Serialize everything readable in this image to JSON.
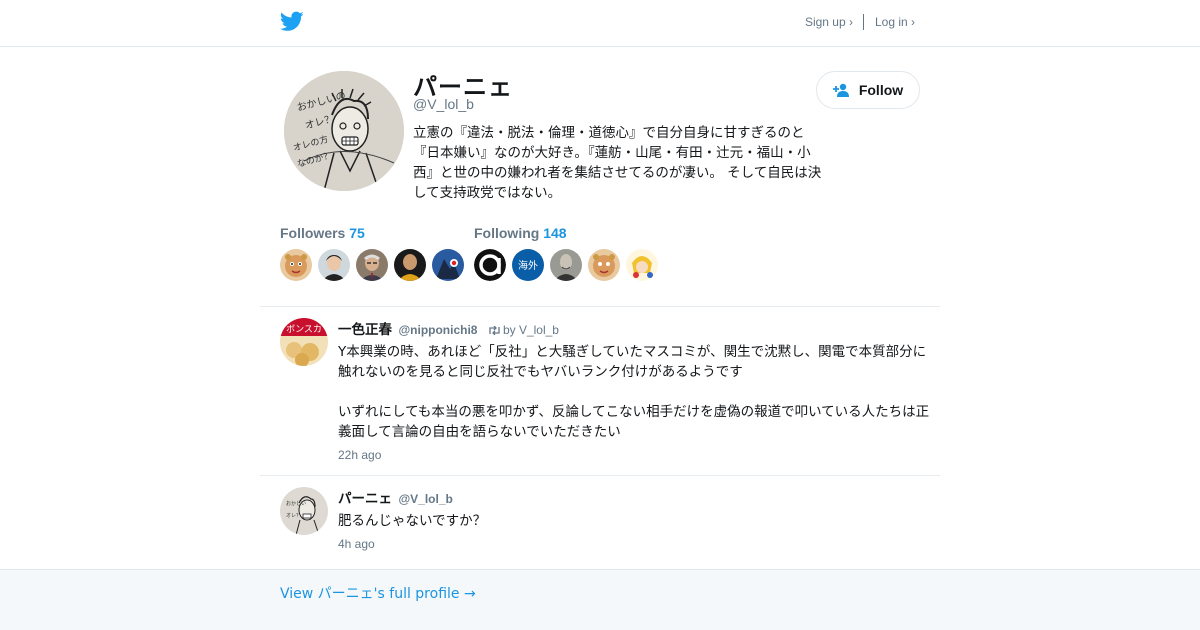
{
  "header": {
    "logo_icon": "twitter-bird-icon",
    "signup_label": "Sign up ›",
    "login_label": "Log in ›"
  },
  "profile": {
    "name": "パーニェ",
    "handle": "@V_lol_b",
    "bio": "立憲の『違法・脱法・倫理・道徳心』で自分自身に甘すぎるのと『日本嫌い』なのが大好き。『蓮舫・山尾・有田・辻元・福山・小西』と世の中の嫌われ者を集結させてるのが凄い。 そして自民は決して支持政党ではない。",
    "follow_label": "Follow",
    "followers_label": "Followers",
    "followers_count": "75",
    "following_label": "Following",
    "following_count": "148"
  },
  "tweets": [
    {
      "name": "一色正春",
      "handle": "@nipponichi8",
      "retweet_by": "by V_lol_b",
      "text": "Y本興業の時、あれほど「反社」と大騒ぎしていたマスコミが、関生で沈黙し、関電で本質部分に触れないのを見ると同じ反社でもヤバいランク付けがあるようです\n\nいずれにしても本当の悪を叩かず、反論してこない相手だけを虚偽の報道で叩いている人たちは正義面して言論の自由を語らないでいただきたい",
      "time": "22h ago"
    },
    {
      "name": "パーニェ",
      "handle": "@V_lol_b",
      "text": "肥るんじゃないですか？",
      "time": "4h ago"
    }
  ],
  "footer": {
    "link": "View パーニェ's full profile →"
  },
  "colors": {
    "accent": "#1b95e0",
    "muted": "#657786",
    "text": "#14171a",
    "border": "#e1e8ed"
  }
}
